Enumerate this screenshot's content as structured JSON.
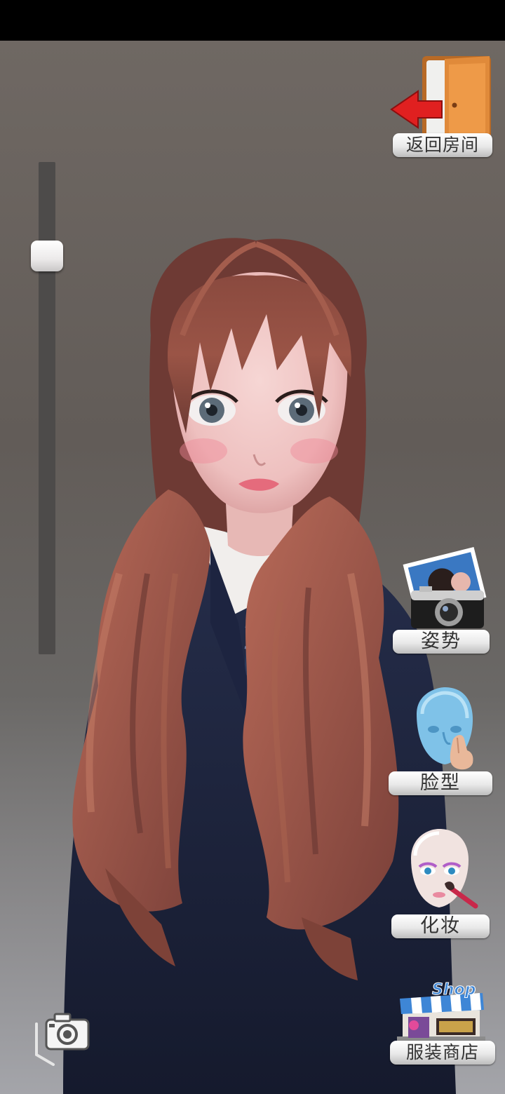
{
  "header": {
    "exit_label": "返回房间"
  },
  "side_menu": {
    "pose_label": "姿势",
    "face_label": "脸型",
    "makeup_label": "化妆",
    "shop_label": "服装商店"
  },
  "slider": {
    "value": 0.17
  },
  "icons": {
    "exit": "exit-door-icon",
    "pose": "camera-photo-icon",
    "face": "face-shape-icon",
    "makeup": "makeup-brush-icon",
    "shop": "shop-store-icon",
    "screenshot": "camera-icon"
  }
}
